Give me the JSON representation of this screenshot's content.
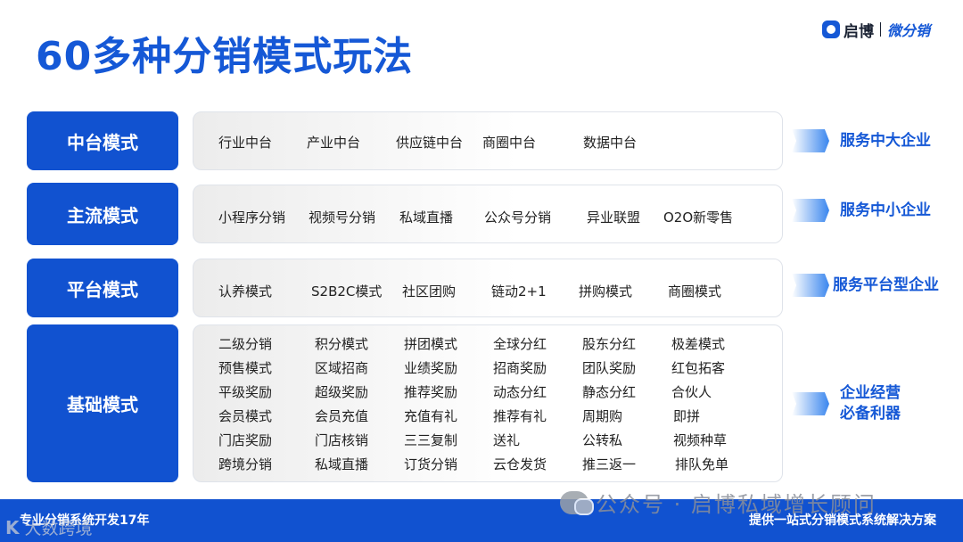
{
  "title": "60多种分销模式玩法",
  "brand": {
    "name": "启博",
    "sub": "微分销"
  },
  "rows": [
    {
      "label": "中台模式",
      "items": [
        "行业中台",
        "产业中台",
        "供应链中台",
        "商圈中台",
        "数据中台"
      ],
      "side": "服务中大企业"
    },
    {
      "label": "主流模式",
      "items": [
        "小程序分销",
        "视频号分销",
        "私域直播",
        "公众号分销",
        "异业联盟",
        "O2O新零售"
      ],
      "side": "服务中小企业"
    },
    {
      "label": "平台模式",
      "items": [
        "认养模式",
        "S2B2C模式",
        "社区团购",
        "链动2+1",
        "拼购模式",
        "商圈模式"
      ],
      "side": "服务平台型企业"
    },
    {
      "label": "基础模式",
      "grid": [
        [
          "二级分销",
          "积分模式",
          "拼团模式",
          "全球分红",
          "股东分红",
          "极差模式"
        ],
        [
          "预售模式",
          "区域招商",
          "业绩奖励",
          "招商奖励",
          "团队奖励",
          "红包拓客"
        ],
        [
          "平级奖励",
          "超级奖励",
          "推荐奖励",
          "动态分红",
          "静态分红",
          "合伙人"
        ],
        [
          "会员模式",
          "会员充值",
          "充值有礼",
          "推荐有礼",
          "周期购",
          "即拼"
        ],
        [
          "门店奖励",
          "门店核销",
          "三三复制",
          "送礼",
          "公转私",
          "视频种草"
        ],
        [
          "跨境分销",
          "私域直播",
          "订货分销",
          "云仓发货",
          "推三返一",
          "排队免单"
        ]
      ],
      "side_lines": [
        "企业经营",
        "必备利器"
      ]
    }
  ],
  "footer": {
    "left": "专业分销系统开发17年",
    "right": "提供一站式分销模式系统解决方案"
  },
  "watermark": {
    "text": "公众号 · 启博私域增长顾问",
    "secondary": "大数跨境"
  },
  "colors": {
    "primary": "#1152d0",
    "accent": "#1558d6"
  }
}
